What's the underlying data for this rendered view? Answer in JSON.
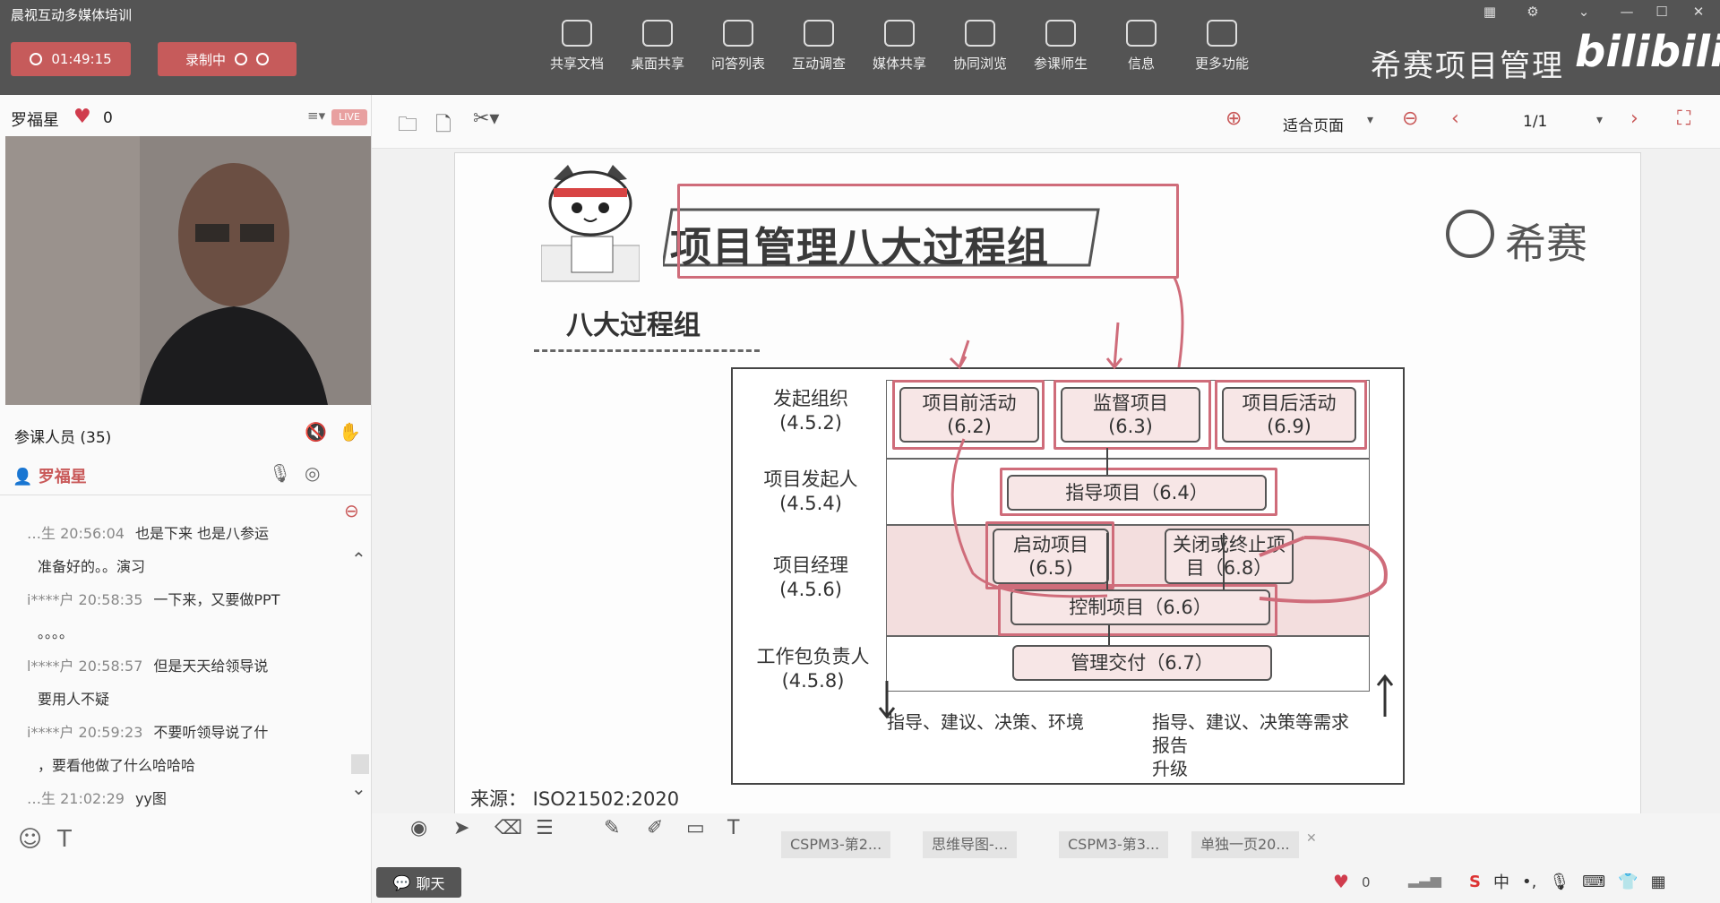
{
  "app": {
    "title": "晨视互动多媒体培训",
    "timer": "01:49:15",
    "record_label": "录制中"
  },
  "toolbar": {
    "items": [
      {
        "label": "共享文档",
        "icon": "document-icon"
      },
      {
        "label": "桌面共享",
        "icon": "monitor-icon"
      },
      {
        "label": "问答列表",
        "icon": "chat-bubbles-icon"
      },
      {
        "label": "互动调查",
        "icon": "bar-chart-icon"
      },
      {
        "label": "媒体共享",
        "icon": "film-icon"
      },
      {
        "label": "协同浏览",
        "icon": "compass-icon"
      },
      {
        "label": "参课师生",
        "icon": "people-icon"
      },
      {
        "label": "信息",
        "icon": "info-icon"
      },
      {
        "label": "更多功能",
        "icon": "more-icon"
      }
    ],
    "brand": "希赛项目管理",
    "bilibili": "bilibili"
  },
  "presenter": {
    "name": "罗福星",
    "likes": "0",
    "badge": "LIVE"
  },
  "participants": {
    "label": "参课人员 (35)",
    "me": "罗福星"
  },
  "chat": {
    "messages": [
      {
        "who": "…生 20:56:04",
        "text": "也是下来 也是八参运"
      },
      {
        "who": "",
        "text": "准备好的。。演习"
      },
      {
        "who": "i****户 20:58:35",
        "text": "一下来，又要做PPT"
      },
      {
        "who": "",
        "text": "。。。。"
      },
      {
        "who": "l****户 20:58:57",
        "text": "但是天天给领导说"
      },
      {
        "who": "",
        "text": "要用人不疑"
      },
      {
        "who": "i****户 20:59:23",
        "text": "不要听领导说了什"
      },
      {
        "who": "",
        "text": "，要看他做了什么哈哈哈"
      },
      {
        "who": "…生 21:02:29",
        "text": "yy图"
      }
    ]
  },
  "viewer": {
    "fit": "适合页面",
    "page": "1/1"
  },
  "slide": {
    "title": "项目管理八大过程组",
    "subtitle": "八大过程组",
    "logo": "希赛",
    "source": "来源： ISO21502:2020",
    "roles": [
      {
        "name": "发起组织",
        "ref": "(4.5.2)"
      },
      {
        "name": "项目发起人",
        "ref": "(4.5.4)"
      },
      {
        "name": "项目经理",
        "ref": "(4.5.6)"
      },
      {
        "name": "工作包负责人",
        "ref": "(4.5.8)"
      }
    ],
    "boxes": {
      "pre": {
        "name": "项目前活动",
        "ref": "(6.2)"
      },
      "monitor": {
        "name": "监督项目",
        "ref": "(6.3)"
      },
      "post": {
        "name": "项目后活动",
        "ref": "(6.9)"
      },
      "direct": "指导项目（6.4）",
      "start": {
        "name": "启动项目",
        "ref": "(6.5)"
      },
      "close": {
        "name": "关闭或终止项",
        "ref": "目（6.8）"
      },
      "control": "控制项目（6.6）",
      "deliver": "管理交付（6.7）"
    },
    "notes": {
      "down": "指导、建议、决策、环境",
      "up": "指导、建议、决策等需求",
      "report": "报告",
      "escalate": "升级"
    }
  },
  "bottom": {
    "tabs": [
      "CSPM3-第2...",
      "思维导图-...",
      "CSPM3-第3...",
      "单独一页20..."
    ],
    "chat_button": "聊天",
    "likes": "0"
  },
  "colors": {
    "topbar": "#545454",
    "accent": "#c65b5b",
    "annotation": "#cf6c7a"
  }
}
